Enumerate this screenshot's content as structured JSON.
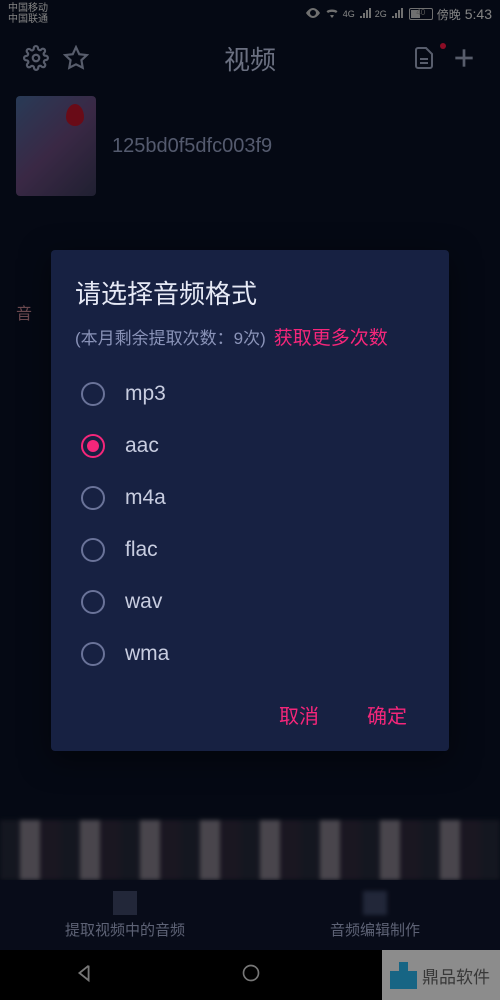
{
  "status": {
    "carrier1": "中国移动",
    "carrier2": "中国联通",
    "net1": "4G",
    "net2": "2G",
    "battery": "40",
    "time_prefix": "傍晚",
    "time": "5:43"
  },
  "header": {
    "title": "视频"
  },
  "list": {
    "item0": {
      "filename": "125bd0f5dfc003f9"
    }
  },
  "side_tab": "音",
  "modal": {
    "title": "请选择音频格式",
    "remain": "(本月剩余提取次数：9次)",
    "get_more": "获取更多次数",
    "options": [
      {
        "label": "mp3",
        "selected": false
      },
      {
        "label": "aac",
        "selected": true
      },
      {
        "label": "m4a",
        "selected": false
      },
      {
        "label": "flac",
        "selected": false
      },
      {
        "label": "wav",
        "selected": false
      },
      {
        "label": "wma",
        "selected": false
      }
    ],
    "cancel": "取消",
    "confirm": "确定"
  },
  "bottom_tabs": {
    "extract": "提取视频中的音频",
    "edit": "音频编辑制作"
  },
  "watermark": "鼎品软件"
}
